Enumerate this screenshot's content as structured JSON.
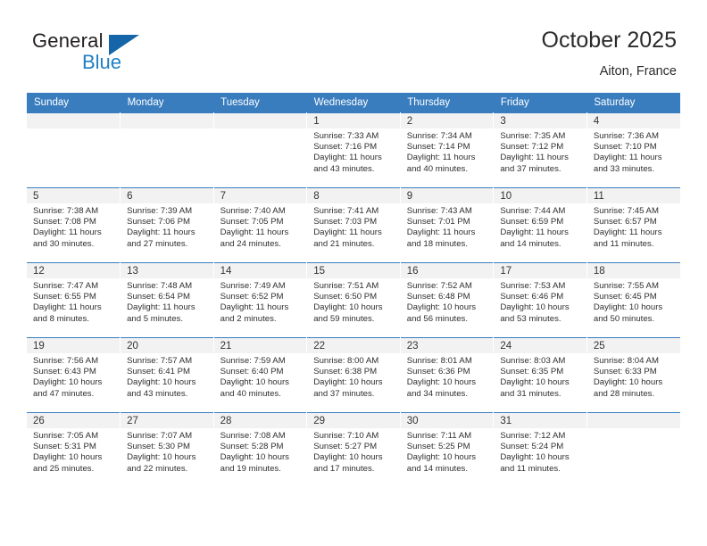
{
  "brand": {
    "name_top": "General",
    "name_bottom": "Blue",
    "triangle_color": "#1565a8",
    "blue_text_color": "#1f7fc4"
  },
  "header": {
    "title": "October 2025",
    "location": "Aiton, France"
  },
  "theme": {
    "header_blue": "#3a7dbf",
    "daynum_strip": "#f2f2f2",
    "text": "#2f2f2f"
  },
  "calendar": {
    "weekday_headers": [
      "Sunday",
      "Monday",
      "Tuesday",
      "Wednesday",
      "Thursday",
      "Friday",
      "Saturday"
    ],
    "labels": {
      "sunrise": "Sunrise:",
      "sunset": "Sunset:",
      "daylight": "Daylight:"
    },
    "weeks": [
      [
        {
          "day": "",
          "empty": true
        },
        {
          "day": "",
          "empty": true
        },
        {
          "day": "",
          "empty": true
        },
        {
          "day": "1",
          "sunrise": "Sunrise: 7:33 AM",
          "sunset": "Sunset: 7:16 PM",
          "daylight_1": "Daylight: 11 hours",
          "daylight_2": "and 43 minutes."
        },
        {
          "day": "2",
          "sunrise": "Sunrise: 7:34 AM",
          "sunset": "Sunset: 7:14 PM",
          "daylight_1": "Daylight: 11 hours",
          "daylight_2": "and 40 minutes."
        },
        {
          "day": "3",
          "sunrise": "Sunrise: 7:35 AM",
          "sunset": "Sunset: 7:12 PM",
          "daylight_1": "Daylight: 11 hours",
          "daylight_2": "and 37 minutes."
        },
        {
          "day": "4",
          "sunrise": "Sunrise: 7:36 AM",
          "sunset": "Sunset: 7:10 PM",
          "daylight_1": "Daylight: 11 hours",
          "daylight_2": "and 33 minutes."
        }
      ],
      [
        {
          "day": "5",
          "sunrise": "Sunrise: 7:38 AM",
          "sunset": "Sunset: 7:08 PM",
          "daylight_1": "Daylight: 11 hours",
          "daylight_2": "and 30 minutes."
        },
        {
          "day": "6",
          "sunrise": "Sunrise: 7:39 AM",
          "sunset": "Sunset: 7:06 PM",
          "daylight_1": "Daylight: 11 hours",
          "daylight_2": "and 27 minutes."
        },
        {
          "day": "7",
          "sunrise": "Sunrise: 7:40 AM",
          "sunset": "Sunset: 7:05 PM",
          "daylight_1": "Daylight: 11 hours",
          "daylight_2": "and 24 minutes."
        },
        {
          "day": "8",
          "sunrise": "Sunrise: 7:41 AM",
          "sunset": "Sunset: 7:03 PM",
          "daylight_1": "Daylight: 11 hours",
          "daylight_2": "and 21 minutes."
        },
        {
          "day": "9",
          "sunrise": "Sunrise: 7:43 AM",
          "sunset": "Sunset: 7:01 PM",
          "daylight_1": "Daylight: 11 hours",
          "daylight_2": "and 18 minutes."
        },
        {
          "day": "10",
          "sunrise": "Sunrise: 7:44 AM",
          "sunset": "Sunset: 6:59 PM",
          "daylight_1": "Daylight: 11 hours",
          "daylight_2": "and 14 minutes."
        },
        {
          "day": "11",
          "sunrise": "Sunrise: 7:45 AM",
          "sunset": "Sunset: 6:57 PM",
          "daylight_1": "Daylight: 11 hours",
          "daylight_2": "and 11 minutes."
        }
      ],
      [
        {
          "day": "12",
          "sunrise": "Sunrise: 7:47 AM",
          "sunset": "Sunset: 6:55 PM",
          "daylight_1": "Daylight: 11 hours",
          "daylight_2": "and 8 minutes."
        },
        {
          "day": "13",
          "sunrise": "Sunrise: 7:48 AM",
          "sunset": "Sunset: 6:54 PM",
          "daylight_1": "Daylight: 11 hours",
          "daylight_2": "and 5 minutes."
        },
        {
          "day": "14",
          "sunrise": "Sunrise: 7:49 AM",
          "sunset": "Sunset: 6:52 PM",
          "daylight_1": "Daylight: 11 hours",
          "daylight_2": "and 2 minutes."
        },
        {
          "day": "15",
          "sunrise": "Sunrise: 7:51 AM",
          "sunset": "Sunset: 6:50 PM",
          "daylight_1": "Daylight: 10 hours",
          "daylight_2": "and 59 minutes."
        },
        {
          "day": "16",
          "sunrise": "Sunrise: 7:52 AM",
          "sunset": "Sunset: 6:48 PM",
          "daylight_1": "Daylight: 10 hours",
          "daylight_2": "and 56 minutes."
        },
        {
          "day": "17",
          "sunrise": "Sunrise: 7:53 AM",
          "sunset": "Sunset: 6:46 PM",
          "daylight_1": "Daylight: 10 hours",
          "daylight_2": "and 53 minutes."
        },
        {
          "day": "18",
          "sunrise": "Sunrise: 7:55 AM",
          "sunset": "Sunset: 6:45 PM",
          "daylight_1": "Daylight: 10 hours",
          "daylight_2": "and 50 minutes."
        }
      ],
      [
        {
          "day": "19",
          "sunrise": "Sunrise: 7:56 AM",
          "sunset": "Sunset: 6:43 PM",
          "daylight_1": "Daylight: 10 hours",
          "daylight_2": "and 47 minutes."
        },
        {
          "day": "20",
          "sunrise": "Sunrise: 7:57 AM",
          "sunset": "Sunset: 6:41 PM",
          "daylight_1": "Daylight: 10 hours",
          "daylight_2": "and 43 minutes."
        },
        {
          "day": "21",
          "sunrise": "Sunrise: 7:59 AM",
          "sunset": "Sunset: 6:40 PM",
          "daylight_1": "Daylight: 10 hours",
          "daylight_2": "and 40 minutes."
        },
        {
          "day": "22",
          "sunrise": "Sunrise: 8:00 AM",
          "sunset": "Sunset: 6:38 PM",
          "daylight_1": "Daylight: 10 hours",
          "daylight_2": "and 37 minutes."
        },
        {
          "day": "23",
          "sunrise": "Sunrise: 8:01 AM",
          "sunset": "Sunset: 6:36 PM",
          "daylight_1": "Daylight: 10 hours",
          "daylight_2": "and 34 minutes."
        },
        {
          "day": "24",
          "sunrise": "Sunrise: 8:03 AM",
          "sunset": "Sunset: 6:35 PM",
          "daylight_1": "Daylight: 10 hours",
          "daylight_2": "and 31 minutes."
        },
        {
          "day": "25",
          "sunrise": "Sunrise: 8:04 AM",
          "sunset": "Sunset: 6:33 PM",
          "daylight_1": "Daylight: 10 hours",
          "daylight_2": "and 28 minutes."
        }
      ],
      [
        {
          "day": "26",
          "sunrise": "Sunrise: 7:05 AM",
          "sunset": "Sunset: 5:31 PM",
          "daylight_1": "Daylight: 10 hours",
          "daylight_2": "and 25 minutes."
        },
        {
          "day": "27",
          "sunrise": "Sunrise: 7:07 AM",
          "sunset": "Sunset: 5:30 PM",
          "daylight_1": "Daylight: 10 hours",
          "daylight_2": "and 22 minutes."
        },
        {
          "day": "28",
          "sunrise": "Sunrise: 7:08 AM",
          "sunset": "Sunset: 5:28 PM",
          "daylight_1": "Daylight: 10 hours",
          "daylight_2": "and 19 minutes."
        },
        {
          "day": "29",
          "sunrise": "Sunrise: 7:10 AM",
          "sunset": "Sunset: 5:27 PM",
          "daylight_1": "Daylight: 10 hours",
          "daylight_2": "and 17 minutes."
        },
        {
          "day": "30",
          "sunrise": "Sunrise: 7:11 AM",
          "sunset": "Sunset: 5:25 PM",
          "daylight_1": "Daylight: 10 hours",
          "daylight_2": "and 14 minutes."
        },
        {
          "day": "31",
          "sunrise": "Sunrise: 7:12 AM",
          "sunset": "Sunset: 5:24 PM",
          "daylight_1": "Daylight: 10 hours",
          "daylight_2": "and 11 minutes."
        },
        {
          "day": "",
          "empty": true
        }
      ]
    ]
  }
}
